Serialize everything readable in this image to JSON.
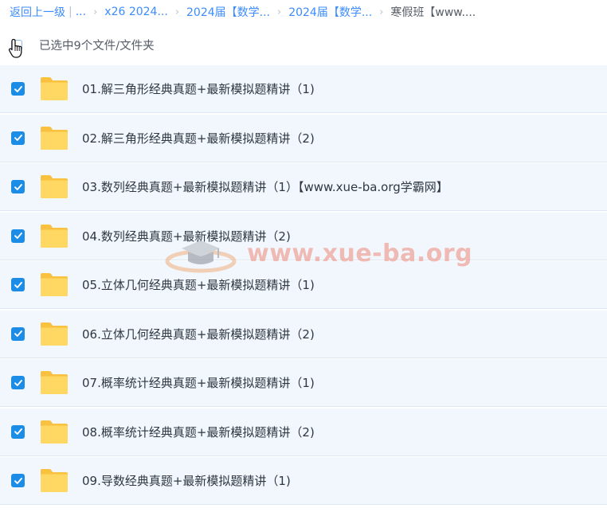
{
  "breadcrumb": {
    "back_label": "返回上一级",
    "separator": "|",
    "ellipsis": "...",
    "chevron": "›",
    "items": [
      {
        "label": "x26 2024..."
      },
      {
        "label": "2024届【数学..."
      },
      {
        "label": "2024届【数学..."
      }
    ],
    "current": "寒假班【www...."
  },
  "selection": {
    "status_text": "已选中9个文件/文件夹",
    "all_selected": true
  },
  "files": [
    {
      "name": "01.解三角形经典真题+最新模拟题精讲（1)",
      "type": "folder",
      "checked": true
    },
    {
      "name": "02.解三角形经典真题+最新模拟题精讲（2)",
      "type": "folder",
      "checked": true
    },
    {
      "name": "03.数列经典真题+最新模拟题精讲（1）【www.xue-ba.org学霸网】",
      "type": "folder",
      "checked": true
    },
    {
      "name": "04.数列经典真题+最新模拟题精讲（2)",
      "type": "folder",
      "checked": true
    },
    {
      "name": "05.立体几何经典真题+最新模拟题精讲（1)",
      "type": "folder",
      "checked": true
    },
    {
      "name": "06.立体几何经典真题+最新模拟题精讲（2)",
      "type": "folder",
      "checked": true
    },
    {
      "name": "07.概率统计经典真题+最新模拟题精讲（1)",
      "type": "folder",
      "checked": true
    },
    {
      "name": "08.概率统计经典真题+最新模拟题精讲（2)",
      "type": "folder",
      "checked": true
    },
    {
      "name": "09.导数经典真题+最新模拟题精讲（1)",
      "type": "folder",
      "checked": true
    }
  ],
  "watermark": {
    "text": "www.xue-ba.org",
    "icon": "graduation-cap-icon"
  },
  "icons": {
    "row_checkbox": "checkbox-checked-icon",
    "folder": "folder-icon",
    "cursor": "hand-pointer-icon"
  },
  "colors": {
    "link": "#3b8cff",
    "checkbox": "#1b8de6",
    "folder": "#fdd25a",
    "row_bg": "#f1f7fd",
    "watermark": "#f08a7a"
  }
}
